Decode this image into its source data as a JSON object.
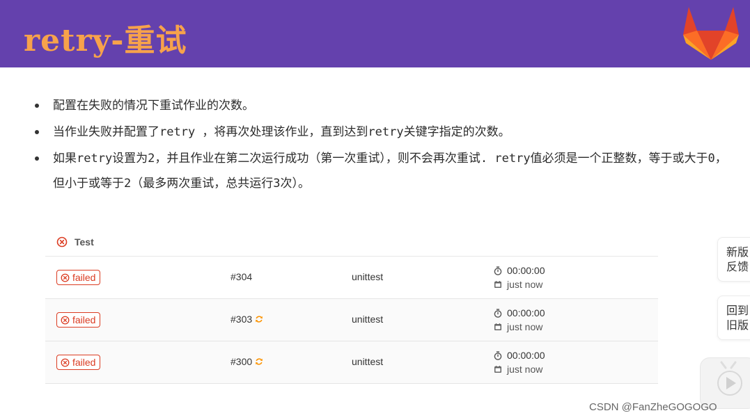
{
  "slide": {
    "title": "retry-重试",
    "colors": {
      "header_bg": "#6441ad",
      "title": "#f7a24b",
      "failed": "#db3b21",
      "retry": "#fc9403"
    },
    "bullets": [
      "配置在失败的情况下重试作业的次数。",
      "当作业失败并配置了retry ，将再次处理该作业，直到达到retry关键字指定的次数。",
      "如果retry设置为2，并且作业在第二次运行成功（第一次重试），则不会再次重试. retry值必须是一个正整数，等于或大于0，但小于或等于2（最多两次重试，总共运行3次）。"
    ]
  },
  "jobs": {
    "stage": {
      "name": "Test",
      "status_icon": "failed-circle-icon"
    },
    "rows": [
      {
        "status": "failed",
        "id": "#304",
        "retried": false,
        "name": "unittest",
        "duration": "00:00:00",
        "finished": "just now"
      },
      {
        "status": "failed",
        "id": "#303",
        "retried": true,
        "name": "unittest",
        "duration": "00:00:00",
        "finished": "just now"
      },
      {
        "status": "failed",
        "id": "#300",
        "retried": true,
        "name": "unittest",
        "duration": "00:00:00",
        "finished": "just now"
      }
    ]
  },
  "side_buttons": {
    "feedback": [
      "新版",
      "反馈"
    ],
    "back_old": [
      "回到",
      "旧版"
    ],
    "play_icon": "play-icon"
  },
  "watermark": "CSDN @FanZheGOGOGO"
}
